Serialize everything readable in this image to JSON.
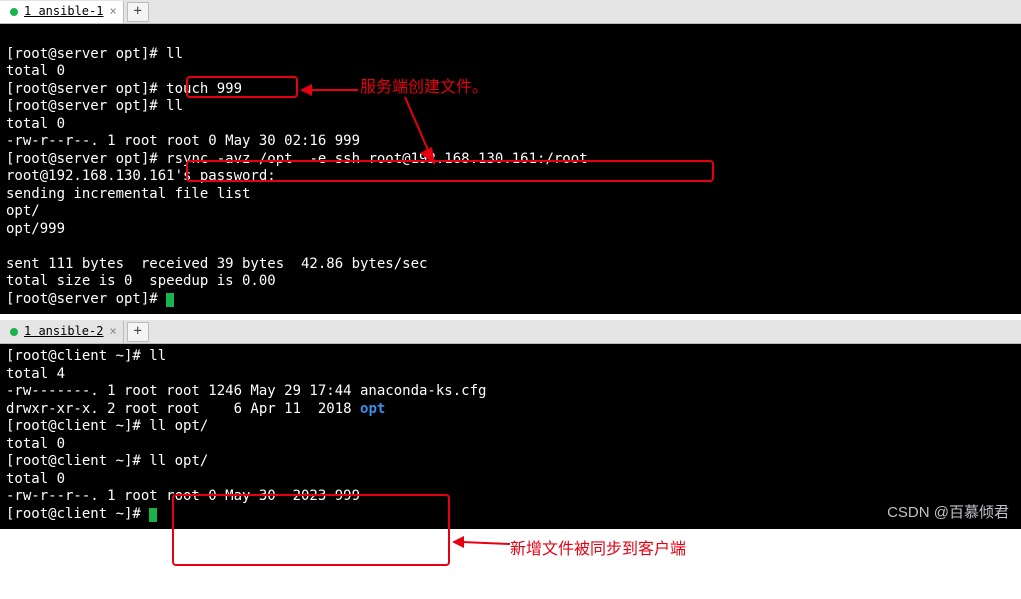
{
  "top": {
    "tab_label": "1 ansible-1",
    "lines": [
      {
        "t": "",
        "p": ""
      },
      {
        "t": "[root@server opt]# ",
        "p": "ll"
      },
      {
        "t": "total 0",
        "p": ""
      },
      {
        "t": "[root@server opt]# ",
        "p": "touch 999"
      },
      {
        "t": "[root@server opt]# ",
        "p": "ll"
      },
      {
        "t": "total 0",
        "p": ""
      },
      {
        "t": "-rw-r--r--. 1 root root 0 May 30 02:16 999",
        "p": ""
      },
      {
        "t": "[root@server opt]# ",
        "p": "rsync -avz /opt  -e ssh root@192.168.130.161:/root"
      },
      {
        "t": "root@192.168.130.161's password:",
        "p": ""
      },
      {
        "t": "sending incremental file list",
        "p": ""
      },
      {
        "t": "opt/",
        "p": ""
      },
      {
        "t": "opt/999",
        "p": ""
      },
      {
        "t": "",
        "p": ""
      },
      {
        "t": "sent 111 bytes  received 39 bytes  42.86 bytes/sec",
        "p": ""
      },
      {
        "t": "total size is 0  speedup is 0.00",
        "p": ""
      },
      {
        "t": "[root@server opt]# ",
        "p": "",
        "cursor": true
      }
    ]
  },
  "bottom": {
    "tab_label": "1 ansible-2",
    "lines": [
      {
        "t": "[root@client ~]# ",
        "p": "ll"
      },
      {
        "t": "total 4",
        "p": ""
      },
      {
        "t": "-rw-------. 1 root root 1246 May 29 17:44 anaconda-ks.cfg",
        "p": ""
      },
      {
        "t": "drwxr-xr-x. 2 root root    6 Apr 11  2018 ",
        "p": "",
        "blue": "opt"
      },
      {
        "t": "[root@client ~]# ",
        "p": "ll opt/"
      },
      {
        "t": "total 0",
        "p": ""
      },
      {
        "t": "[root@client ~]# ",
        "p": "ll opt/"
      },
      {
        "t": "total 0",
        "p": ""
      },
      {
        "t": "-rw-r--r--. 1 root root 0 May 30  2023 999",
        "p": ""
      },
      {
        "t": "[root@client ~]# ",
        "p": "",
        "cursor": true
      }
    ]
  },
  "annotations": {
    "note1": "服务端创建文件。",
    "note2": "新增文件被同步到客户端"
  },
  "watermark": "CSDN @百慕倾君",
  "plus": "+",
  "close_x": "×"
}
